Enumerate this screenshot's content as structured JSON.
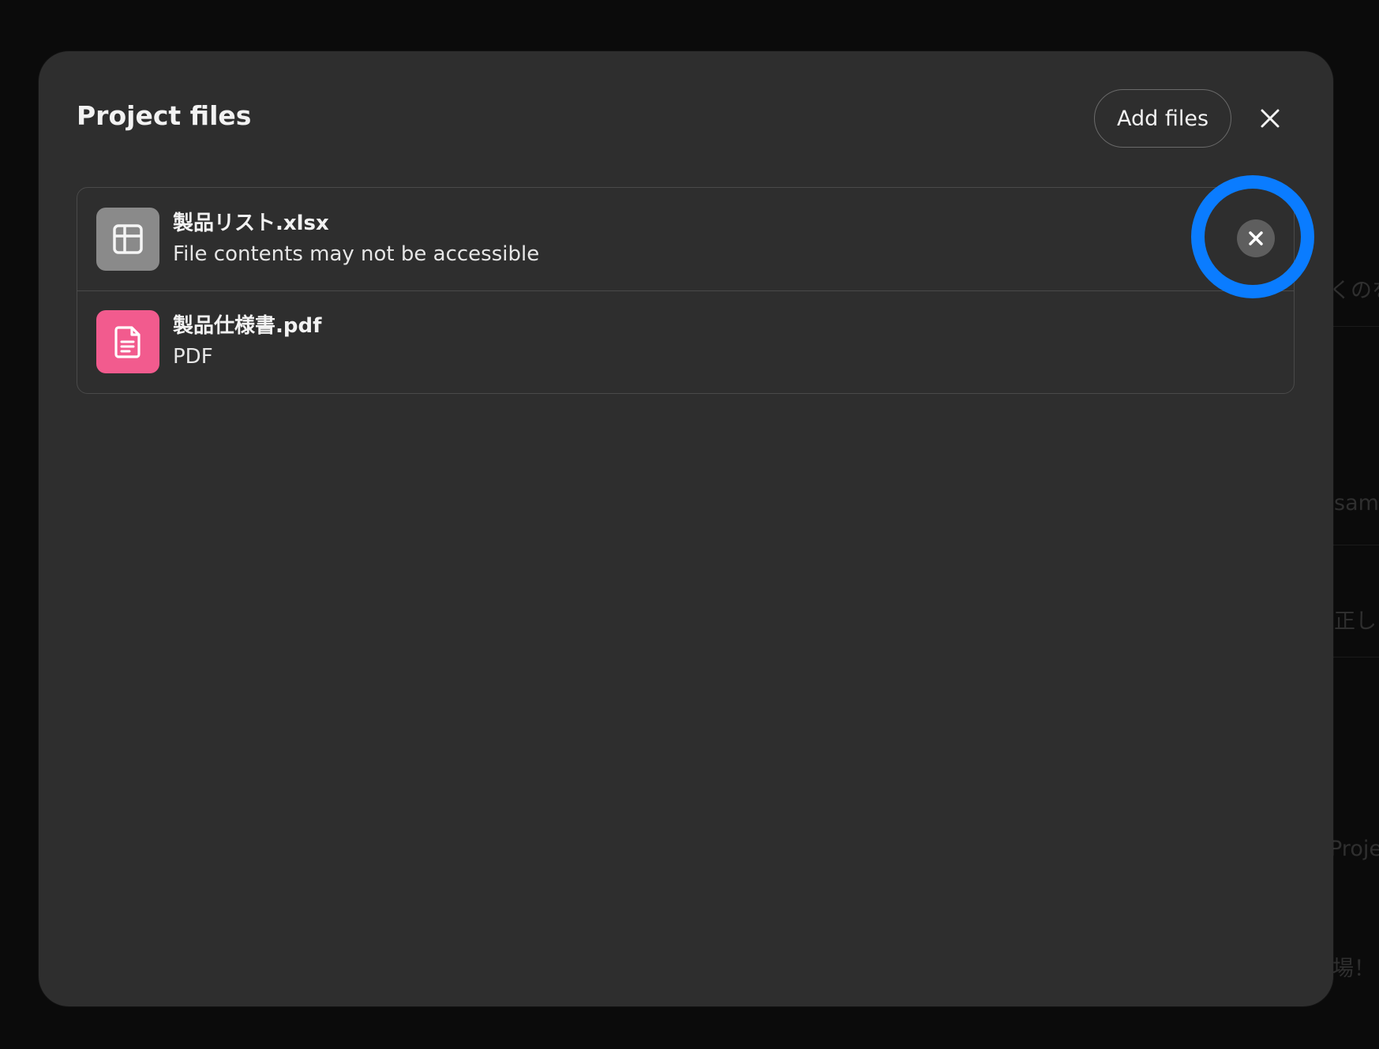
{
  "background": {
    "peek_texts": [
      "くのを",
      "sam",
      "正し",
      "Proje",
      "場！"
    ]
  },
  "modal": {
    "title": "Project files",
    "add_files_label": "Add files",
    "close_icon": "close-icon"
  },
  "files": [
    {
      "name": "製品リスト.xlsx",
      "subtitle": "File contents may not be accessible",
      "icon": "spreadsheet-icon",
      "icon_color": "#8a8a8a"
    },
    {
      "name": "製品仕様書.pdf",
      "subtitle": "PDF",
      "icon": "document-icon",
      "icon_color": "#f25b8e"
    }
  ],
  "remove_button": {
    "icon": "remove-x-icon",
    "color": "#5e5e5e"
  },
  "highlight": {
    "color": "#0a7cff"
  }
}
